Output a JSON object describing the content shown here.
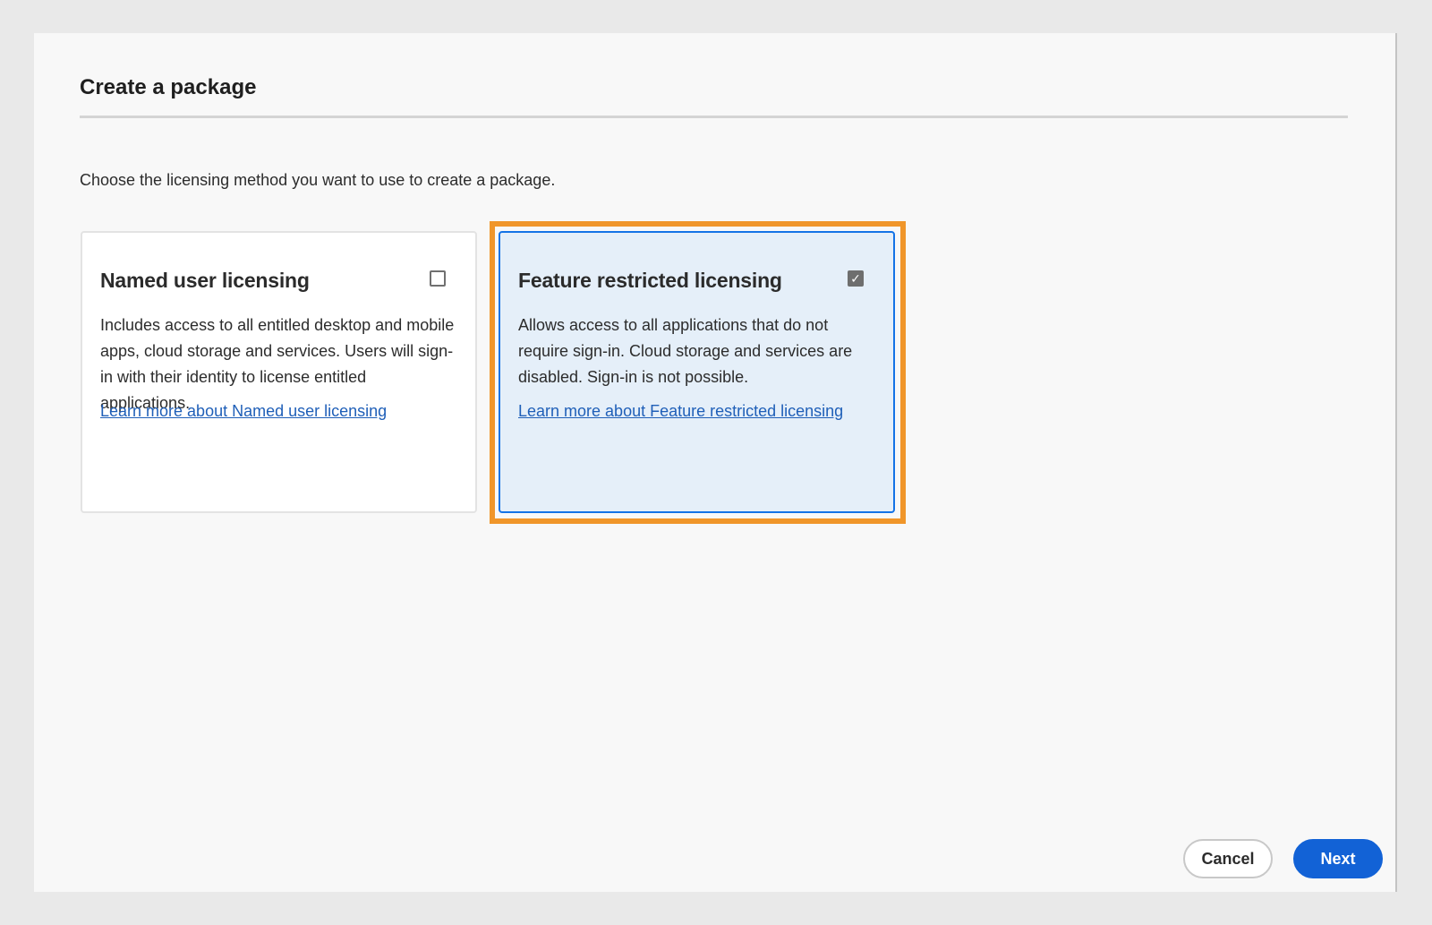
{
  "dialog": {
    "title": "Create a package",
    "instructions": "Choose the licensing method you want to use to create a package."
  },
  "options": [
    {
      "title": "Named user licensing",
      "description": "Includes access to all entitled desktop and mobile apps, cloud storage and services. Users will sign-in with their identity to license entitled applications.",
      "link": "Learn more about Named user licensing",
      "checked": false
    },
    {
      "title": "Feature restricted licensing",
      "description": "Allows access to all applications that do not require sign-in. Cloud storage and services are disabled. Sign-in is not possible.",
      "link": "Learn more about Feature restricted licensing",
      "checked": true
    }
  ],
  "footer": {
    "cancel_label": "Cancel",
    "next_label": "Next"
  },
  "colors": {
    "accent": "#1262d6",
    "selected_card_bg": "#e5eff9",
    "highlight_frame": "#f0962a",
    "link": "#1f5fb8"
  },
  "icons": {
    "unchecked": "checkbox-unchecked-icon",
    "checked": "checkbox-checked-icon",
    "checkmark_glyph": "✓"
  }
}
